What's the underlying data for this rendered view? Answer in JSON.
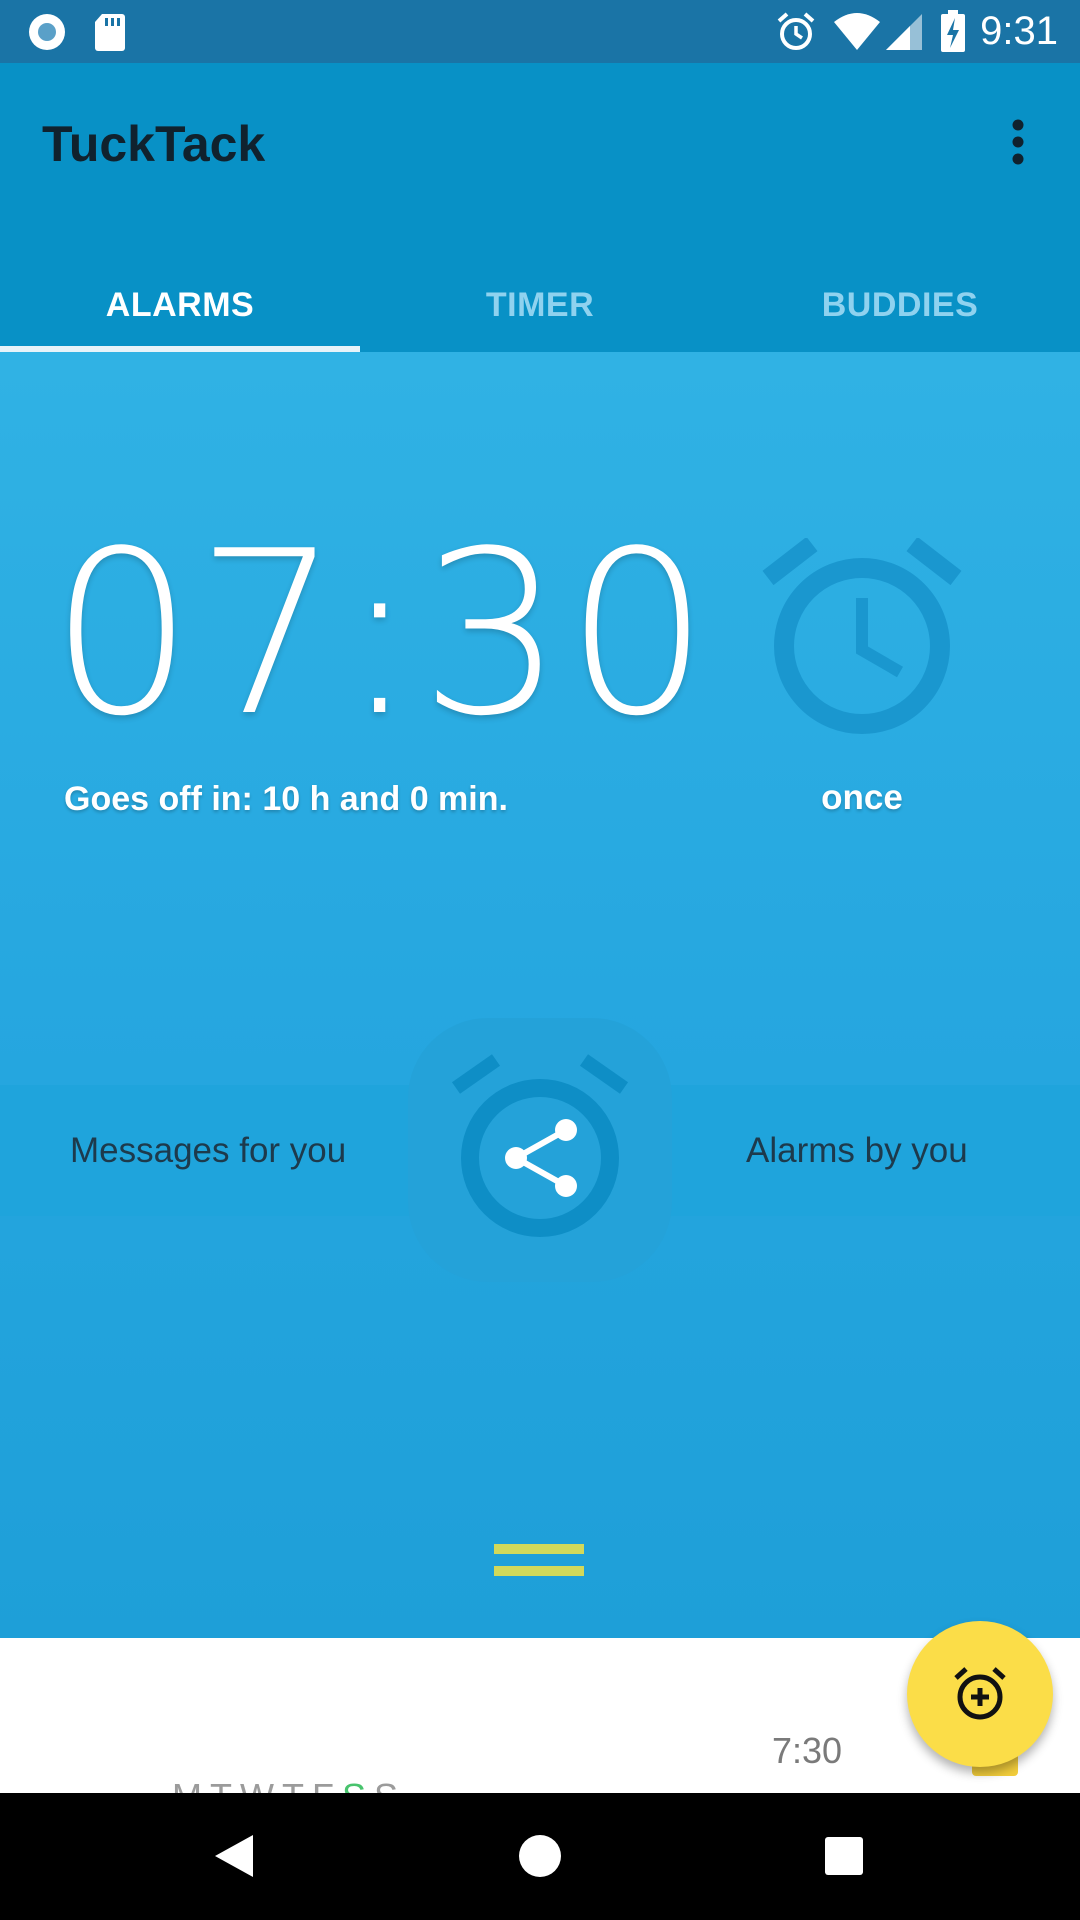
{
  "status_bar": {
    "time": "9:31",
    "icons": [
      "record-icon",
      "sd-card-icon",
      "alarm-icon",
      "wifi-icon",
      "signal-icon",
      "battery-charging-icon"
    ]
  },
  "app_bar": {
    "title": "TuckTack",
    "menu_icon": "more-vert-icon"
  },
  "tabs": [
    {
      "label": "ALARMS",
      "active": true
    },
    {
      "label": "TIMER",
      "active": false
    },
    {
      "label": "BUDDIES",
      "active": false
    }
  ],
  "next_alarm": {
    "time": "07:30",
    "goes_off_in": "Goes off in: 10 h and 0 min.",
    "repeat_label": "once",
    "repeat_icon": "alarm-clock-icon"
  },
  "share_section": {
    "messages_label": "Messages for you",
    "alarms_label": "Alarms by you",
    "share_icon": "share-alarm-icon"
  },
  "alarm_list": [
    {
      "time": "7:30",
      "days": [
        "M",
        "T",
        "W",
        "T",
        "F",
        "S",
        "S"
      ],
      "active_day_index": 5
    }
  ],
  "fab": {
    "icon": "add-alarm-icon"
  },
  "nav_bar": {
    "icons": [
      "back-icon",
      "home-icon",
      "recents-icon"
    ]
  },
  "colors": {
    "status_bar": "#1a74a6",
    "app_bar": "#0891c6",
    "content": "#30b2e4",
    "fab": "#fbdd48",
    "accent_day": "#48c36d",
    "drag_handle": "#d2d95a"
  }
}
